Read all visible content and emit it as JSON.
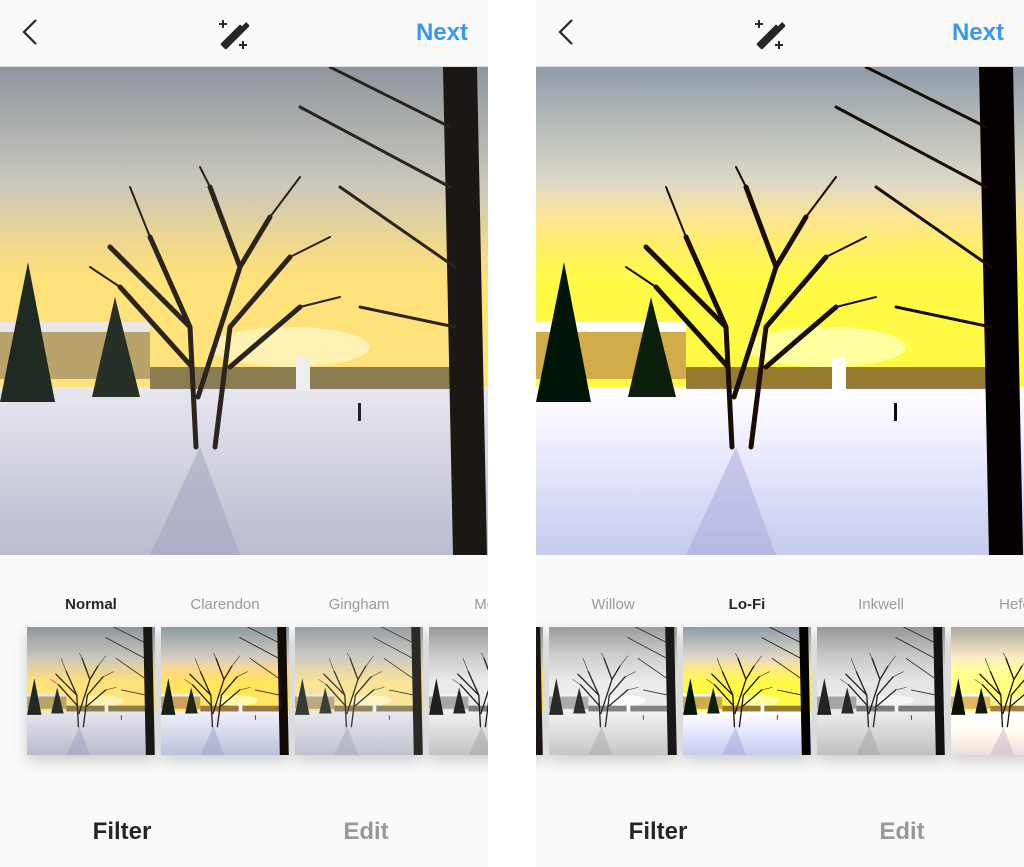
{
  "panels": [
    {
      "header": {
        "back_icon": "chevron-left-icon",
        "lux_icon": "magic-wand-icon",
        "next_label": "Next"
      },
      "filters": [
        {
          "label": "Normal",
          "selected": true
        },
        {
          "label": "Clarendon"
        },
        {
          "label": "Gingham"
        },
        {
          "label": "Moon"
        }
      ],
      "filter_offset": 0,
      "tabs": [
        {
          "label": "Filter",
          "active": true
        },
        {
          "label": "Edit"
        }
      ]
    },
    {
      "header": {
        "back_icon": "chevron-left-icon",
        "lux_icon": "magic-wand-icon",
        "next_label": "Next"
      },
      "filters": [
        {
          "label": "Willow"
        },
        {
          "label": "Lo-Fi",
          "selected": true
        },
        {
          "label": "Inkwell"
        },
        {
          "label": "Hefe"
        }
      ],
      "filter_offset": 1,
      "tabs": [
        {
          "label": "Filter",
          "active": true
        },
        {
          "label": "Edit"
        }
      ]
    }
  ],
  "colors": {
    "accent": "#3897f0",
    "text": "#262626",
    "muted": "#999999"
  }
}
